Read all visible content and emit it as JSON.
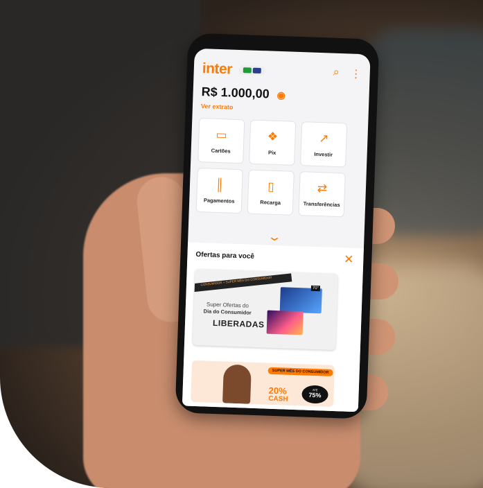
{
  "app": {
    "logo": "inter",
    "balance": "R$ 1.000,00",
    "statement_link": "Ver extrato",
    "brand_color": "#ff7a00"
  },
  "header_icons": [
    "search-icon",
    "more-vertical-icon"
  ],
  "actions": [
    {
      "label": "Cartões",
      "icon": "card-icon"
    },
    {
      "label": "Pix",
      "icon": "pix-icon"
    },
    {
      "label": "Investir",
      "icon": "trend-up-icon"
    },
    {
      "label": "Pagamentos",
      "icon": "barcode-icon"
    },
    {
      "label": "Recarga",
      "icon": "phone-icon"
    },
    {
      "label": "Transferências",
      "icon": "transfer-icon"
    }
  ],
  "offers": {
    "title": "Ofertas para você",
    "banner1": {
      "ribbon": "CONSUMIDOR + SUPER MÊS DO CONSUMIDOR",
      "line1": "Super Ofertas do",
      "line2": "Dia do Consumidor",
      "line3": "LIBERADAS",
      "tv_tag": "70\""
    },
    "banner2": {
      "tag": "SUPER MÊS DO CONSUMIDOR",
      "percent": "20%",
      "cash": "CASH",
      "badge_top": "ATÉ",
      "badge_value": "75%"
    }
  }
}
